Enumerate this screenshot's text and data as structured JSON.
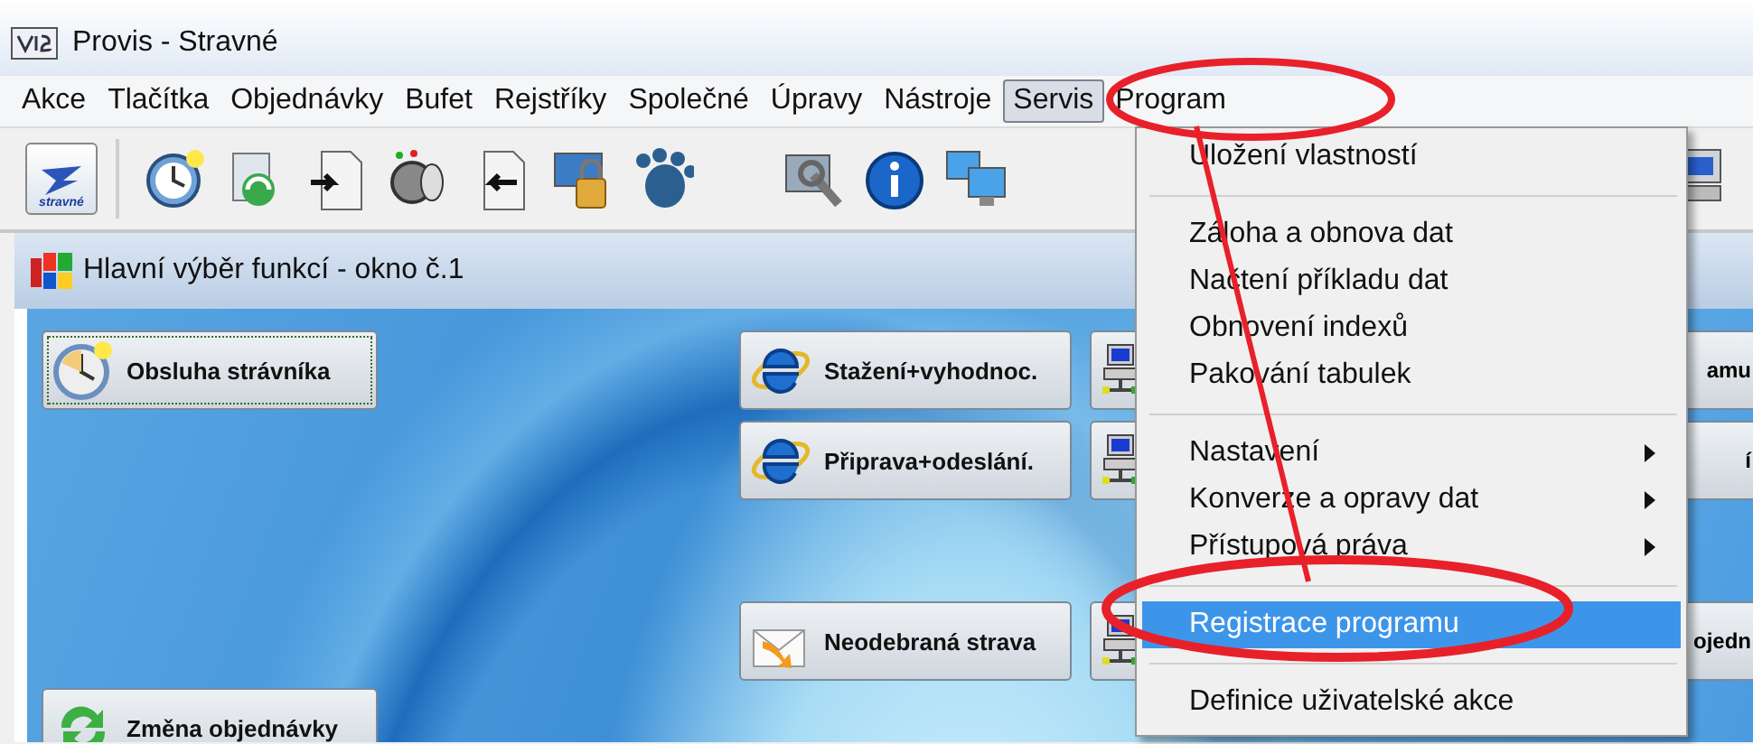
{
  "window": {
    "title": "Provis - Stravné"
  },
  "menu_bar": [
    {
      "label": "Akce",
      "selected": false
    },
    {
      "label": "Tlačítka",
      "selected": false
    },
    {
      "label": "Objednávky",
      "selected": false
    },
    {
      "label": "Bufet",
      "selected": false
    },
    {
      "label": "Rejstříky",
      "selected": false
    },
    {
      "label": "Společné",
      "selected": false
    },
    {
      "label": "Úpravy",
      "selected": false
    },
    {
      "label": "Nástroje",
      "selected": false
    },
    {
      "label": "Servis",
      "selected": true
    },
    {
      "label": "Program",
      "selected": false
    }
  ],
  "toolbar": {
    "logo_text": "stravné"
  },
  "inner_window": {
    "title": "Hlavní výběr funkcí - okno č.1"
  },
  "function_buttons": [
    {
      "label": "Obsluha strávníka",
      "kind": "clock",
      "focused": true
    },
    {
      "label": "Stažení+vyhodnoc.",
      "kind": "browser",
      "focused": false
    },
    {
      "label": "Připrava+odeslání.",
      "kind": "browser",
      "focused": false
    },
    {
      "label": "Neodebraná strava",
      "kind": "mail",
      "focused": false
    },
    {
      "label": "Změna objednávky",
      "kind": "refresh",
      "focused": false
    }
  ],
  "partial_buttons": [
    {
      "label": "amu"
    },
    {
      "label": "í"
    },
    {
      "label": "ojedn"
    }
  ],
  "dropdown": {
    "items": [
      {
        "kind": "item",
        "label": "Uložení vlastností",
        "submenu": false,
        "selected": false
      },
      {
        "kind": "separator"
      },
      {
        "kind": "item",
        "label": "Záloha a obnova dat",
        "submenu": false,
        "selected": false
      },
      {
        "kind": "item",
        "label": "Načtení příkladu dat",
        "submenu": false,
        "selected": false
      },
      {
        "kind": "item",
        "label": "Obnovení indexů",
        "submenu": false,
        "selected": false
      },
      {
        "kind": "item",
        "label": "Pakování tabulek",
        "submenu": false,
        "selected": false
      },
      {
        "kind": "separator"
      },
      {
        "kind": "item",
        "label": "Nastavení",
        "submenu": true,
        "selected": false
      },
      {
        "kind": "item",
        "label": "Konverze a opravy dat",
        "submenu": true,
        "selected": false
      },
      {
        "kind": "item",
        "label": "Přístupová práva",
        "submenu": true,
        "selected": false
      },
      {
        "kind": "separator"
      },
      {
        "kind": "item",
        "label": "Registrace programu",
        "submenu": false,
        "selected": true
      },
      {
        "kind": "separator"
      },
      {
        "kind": "item",
        "label": "Definice uživatelské akce",
        "submenu": false,
        "selected": false
      }
    ]
  }
}
